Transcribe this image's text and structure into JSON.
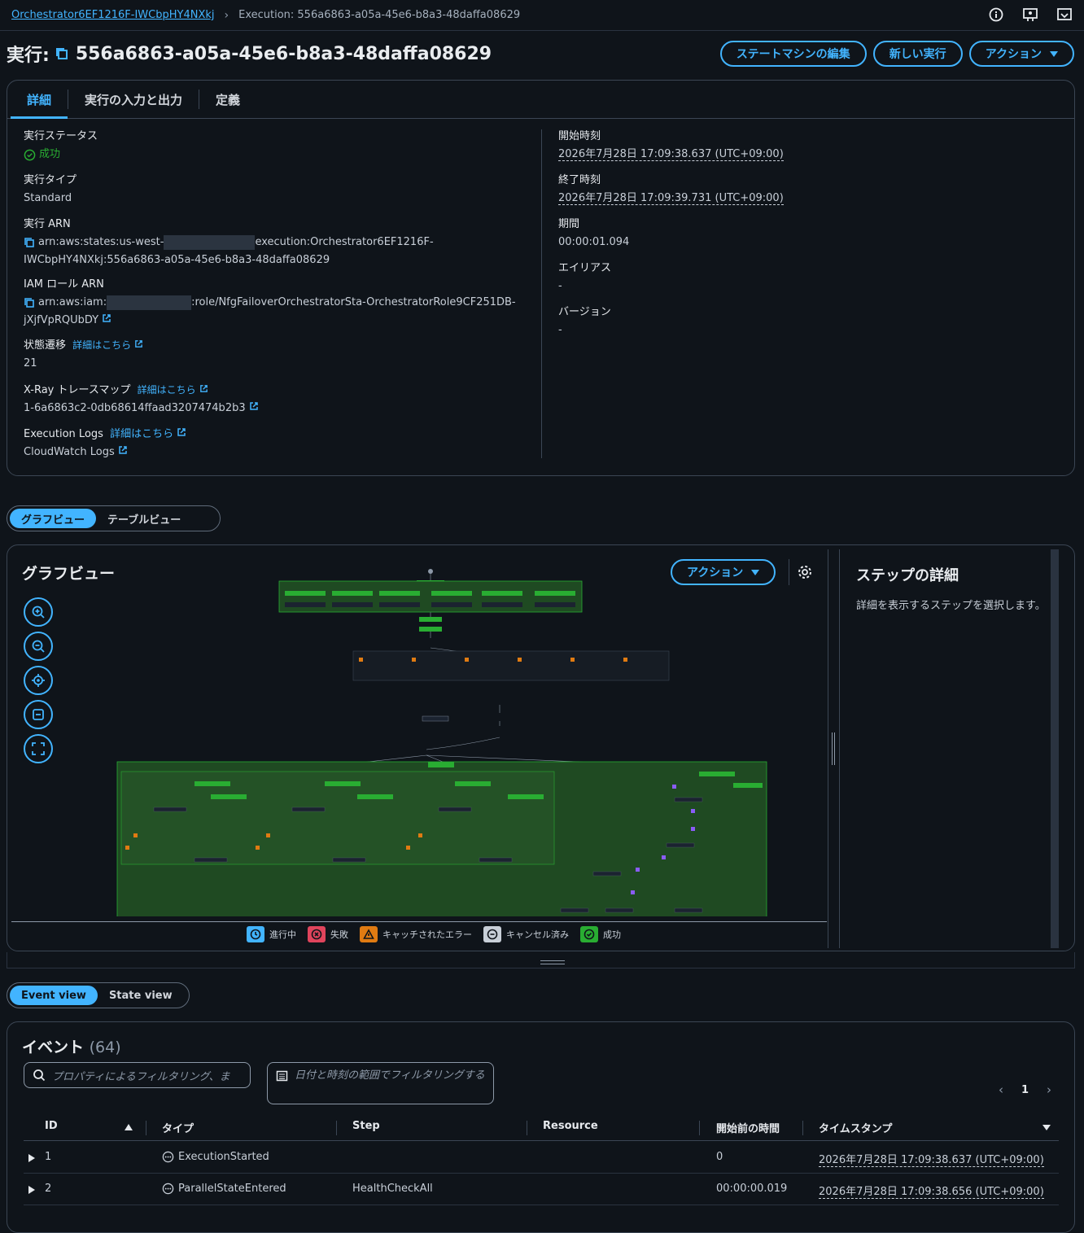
{
  "breadcrumb": {
    "parent": "Orchestrator6EF1216F-IWCbpHY4NXkj",
    "current": "Execution: 556a6863-a05a-45e6-b8a3-48daffa08629"
  },
  "header": {
    "title_prefix": "実行:",
    "execution_id": "556a6863-a05a-45e6-b8a3-48daffa08629",
    "edit_button": "ステートマシンの編集",
    "new_button": "新しい実行",
    "actions_button": "アクション"
  },
  "tabs": [
    "詳細",
    "実行の入力と出力",
    "定義"
  ],
  "details": {
    "status_label": "実行ステータス",
    "status_value": "成功",
    "type_label": "実行タイプ",
    "type_value": "Standard",
    "arn_label": "実行 ARN",
    "arn_part1": "arn:aws:states:us-west-",
    "arn_part2": "execution:Orchestrator6EF1216F-",
    "arn_part3": "IWCbpHY4NXkj:556a6863-a05a-45e6-b8a3-48daffa08629",
    "iam_label": "IAM ロール ARN",
    "iam_part1": "arn:aws:iam:",
    "iam_part2": ":role/NfgFailoverOrchestratorSta-OrchestratorRole9CF251DB-",
    "iam_part3": "jXjfVpRQUbDY",
    "transitions_label": "状態遷移",
    "transitions_link": "詳細はこちら",
    "transitions_value": "21",
    "xray_label": "X-Ray トレースマップ",
    "xray_link": "詳細はこちら",
    "xray_value": "1-6a6863c2-0db68614ffaad3207474b2b3",
    "logs_label": "Execution Logs",
    "logs_link": "詳細はこちら",
    "logs_value": "CloudWatch Logs",
    "start_label": "開始時刻",
    "start_value": "2026年7月28日 17:09:38.637 (UTC+09:00)",
    "end_label": "終了時刻",
    "end_value": "2026年7月28日 17:09:39.731 (UTC+09:00)",
    "duration_label": "期間",
    "duration_value": "00:00:01.094",
    "alias_label": "エイリアス",
    "alias_value": "-",
    "version_label": "バージョン",
    "version_value": "-"
  },
  "view_toggle": {
    "graph": "グラフビュー",
    "table": "テーブルビュー"
  },
  "graph": {
    "title": "グラフビュー",
    "actions": "アクション",
    "legend": [
      "進行中",
      "失敗",
      "キャッチされたエラー",
      "キャンセル済み",
      "成功"
    ],
    "step_title": "ステップの詳細",
    "step_hint": "詳細を表示するステップを選択します。"
  },
  "event_toggle": {
    "event": "Event view",
    "state": "State view"
  },
  "events": {
    "title": "イベント",
    "count": "(64)",
    "filter_placeholder": "プロパティによるフィルタリング、ま",
    "date_filter": "日付と時刻の範囲でフィルタリングする",
    "page": "1",
    "columns": [
      "ID",
      "タイプ",
      "Step",
      "Resource",
      "開始前の時間",
      "タイムスタンプ"
    ],
    "rows": [
      {
        "id": "1",
        "type": "ExecutionStarted",
        "step": "",
        "resource": "",
        "elapsed": "0",
        "timestamp": "2026年7月28日 17:09:38.637 (UTC+09:00)"
      },
      {
        "id": "2",
        "type": "ParallelStateEntered",
        "step": "HealthCheckAll",
        "resource": "",
        "elapsed": "00:00:00.019",
        "timestamp": "2026年7月28日 17:09:38.656 (UTC+09:00)"
      }
    ]
  },
  "colors": {
    "accent": "#42b4ff",
    "success": "#29ad32",
    "background": "#0f141a"
  }
}
